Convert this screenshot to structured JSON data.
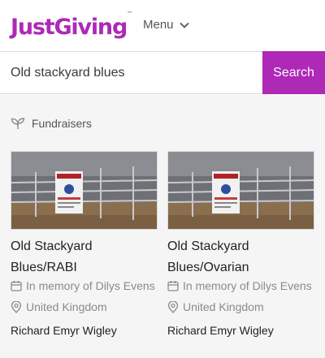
{
  "header": {
    "logo": "JustGiving",
    "logo_tm": "™",
    "menu_label": "Menu"
  },
  "search": {
    "value": "Old stackyard blues",
    "button_label": "Search"
  },
  "results": {
    "section_label": "Fundraisers",
    "cards": [
      {
        "title_line1": "Old Stackyard",
        "title_line2": "Blues/RABI",
        "memory": "In memory of Dilys Evens",
        "location": "United Kingdom",
        "owner": "Richard Emyr Wigley"
      },
      {
        "title_line1": "Old Stackyard",
        "title_line2": "Blues/Ovarian",
        "memory": "In memory of Dilys Evens",
        "location": "United Kingdom",
        "owner": "Richard Emyr Wigley"
      }
    ]
  },
  "colors": {
    "brand": "#ad29b6",
    "meta_text": "#8a8a8a"
  },
  "icons": {
    "menu": "chevron-down-icon",
    "section": "sprout-icon",
    "memory": "calendar-icon",
    "location": "location-pin-icon"
  }
}
